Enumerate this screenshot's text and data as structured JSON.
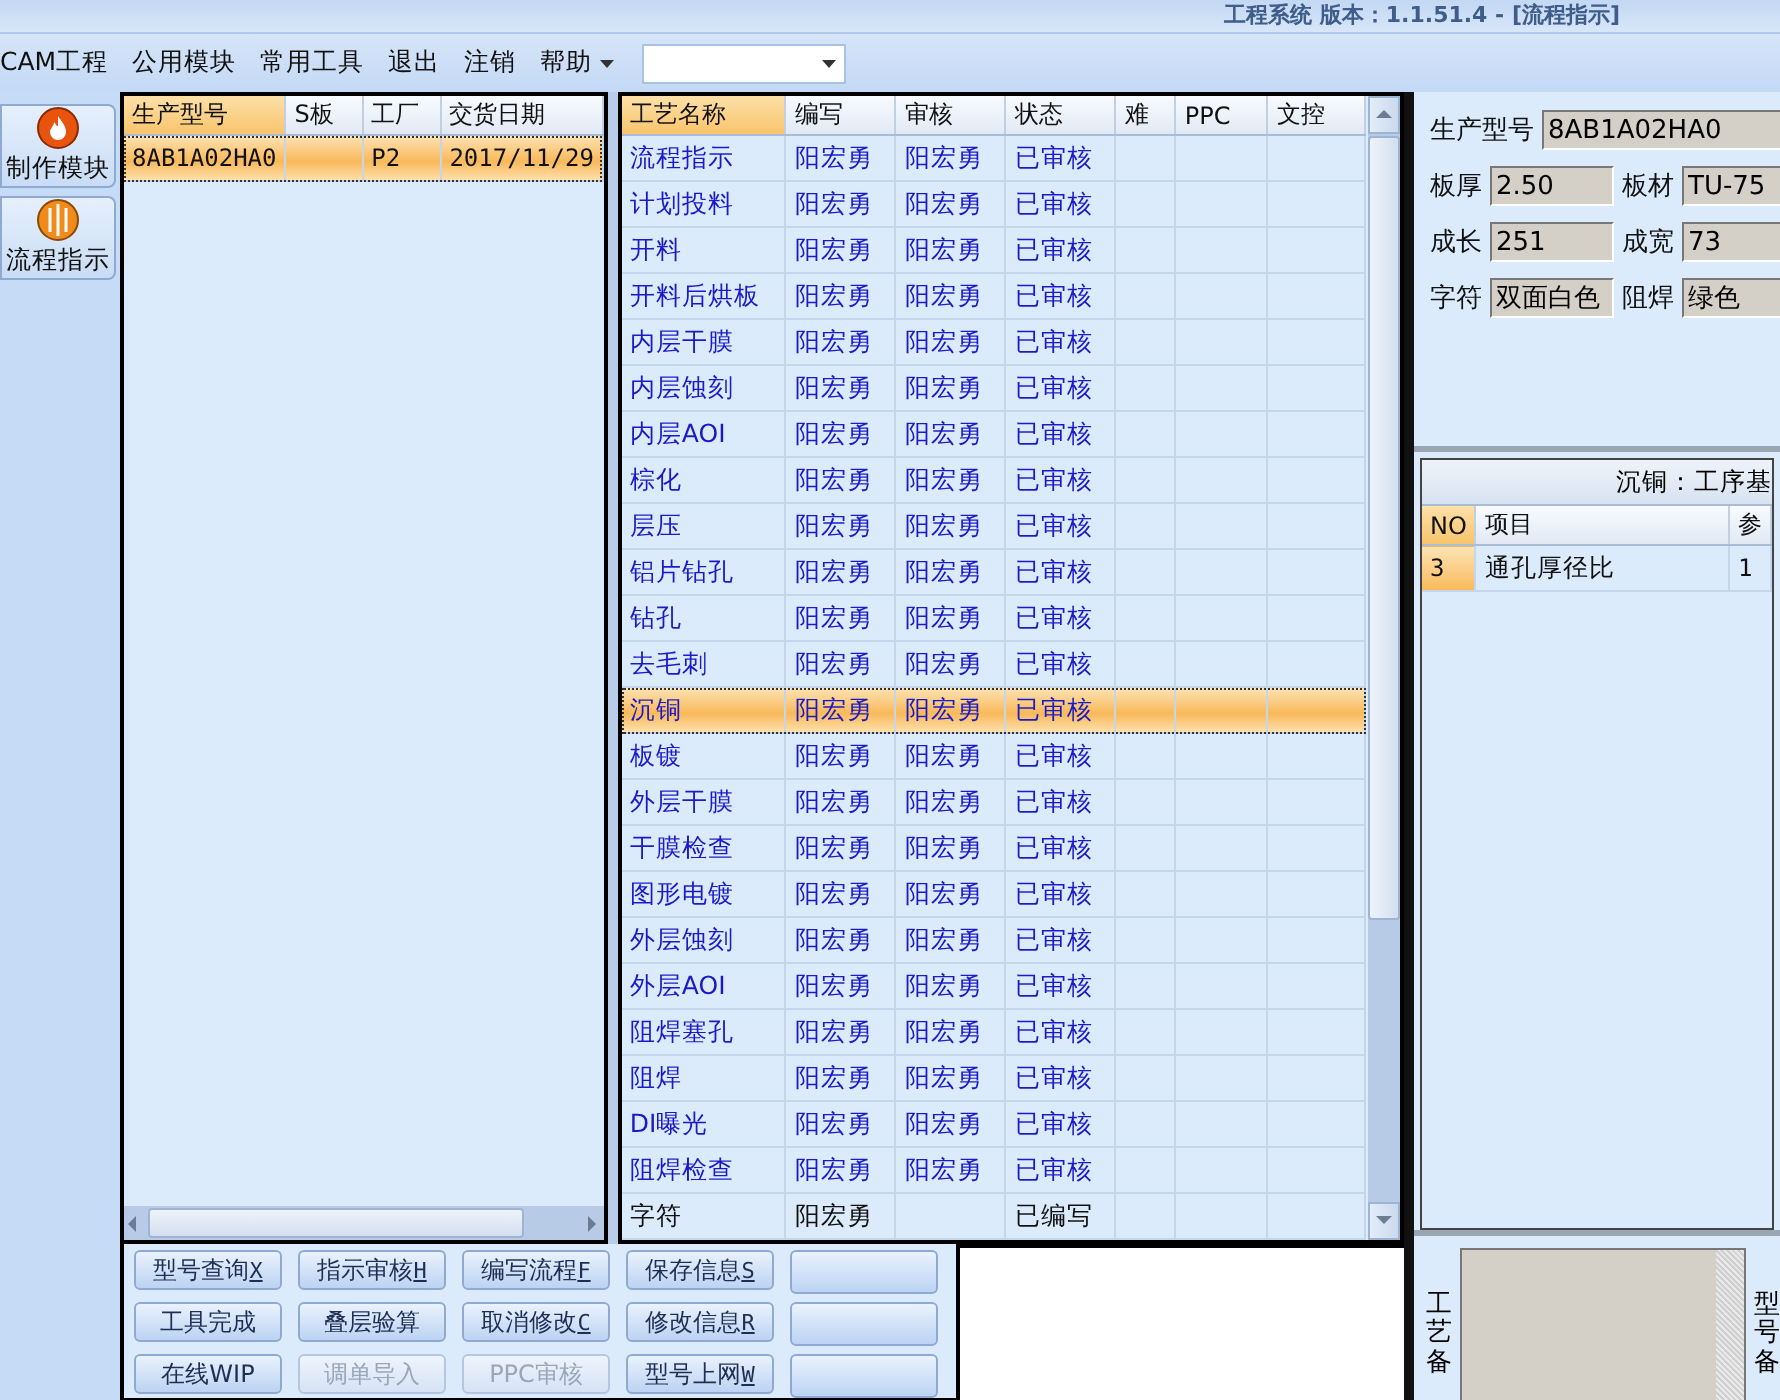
{
  "window": {
    "title": "工程系统 版本：1.1.51.4 - [流程指示]"
  },
  "menu": {
    "items": [
      {
        "label": "CAM工程",
        "dropdown": false
      },
      {
        "label": "公用模块",
        "dropdown": false
      },
      {
        "label": "常用工具",
        "dropdown": false
      },
      {
        "label": "退出",
        "dropdown": false
      },
      {
        "label": "注销",
        "dropdown": false
      },
      {
        "label": "帮助",
        "dropdown": true
      }
    ]
  },
  "sidebar": {
    "items": [
      {
        "label": "制作模块",
        "kind": "flame"
      },
      {
        "label": "流程指示",
        "kind": "globe"
      }
    ]
  },
  "orders": {
    "columns": [
      {
        "label": "生产型号",
        "sorted": true
      },
      {
        "label": "S板",
        "sorted": false
      },
      {
        "label": "工厂",
        "sorted": false
      },
      {
        "label": "交货日期",
        "sorted": false
      }
    ],
    "rows": [
      {
        "cells": [
          "8AB1A02HA0",
          "",
          "P2",
          "2017/11/29"
        ],
        "selected": true
      }
    ]
  },
  "processes": {
    "columns": [
      {
        "label": "工艺名称",
        "sorted": true
      },
      {
        "label": "编写",
        "sorted": false
      },
      {
        "label": "审核",
        "sorted": false
      },
      {
        "label": "状态",
        "sorted": false
      },
      {
        "label": "难",
        "sorted": false
      },
      {
        "label": "PPC",
        "sorted": false
      },
      {
        "label": "文控",
        "sorted": false
      }
    ],
    "rows": [
      {
        "cells": [
          "流程指示",
          "阳宏勇",
          "阳宏勇",
          "已审核",
          "",
          "",
          ""
        ],
        "reviewed": true,
        "selected": false
      },
      {
        "cells": [
          "计划投料",
          "阳宏勇",
          "阳宏勇",
          "已审核",
          "",
          "",
          ""
        ],
        "reviewed": true,
        "selected": false
      },
      {
        "cells": [
          "开料",
          "阳宏勇",
          "阳宏勇",
          "已审核",
          "",
          "",
          ""
        ],
        "reviewed": true,
        "selected": false
      },
      {
        "cells": [
          "开料后烘板",
          "阳宏勇",
          "阳宏勇",
          "已审核",
          "",
          "",
          ""
        ],
        "reviewed": true,
        "selected": false
      },
      {
        "cells": [
          "内层干膜",
          "阳宏勇",
          "阳宏勇",
          "已审核",
          "",
          "",
          ""
        ],
        "reviewed": true,
        "selected": false
      },
      {
        "cells": [
          "内层蚀刻",
          "阳宏勇",
          "阳宏勇",
          "已审核",
          "",
          "",
          ""
        ],
        "reviewed": true,
        "selected": false
      },
      {
        "cells": [
          "内层AOI",
          "阳宏勇",
          "阳宏勇",
          "已审核",
          "",
          "",
          ""
        ],
        "reviewed": true,
        "selected": false
      },
      {
        "cells": [
          "棕化",
          "阳宏勇",
          "阳宏勇",
          "已审核",
          "",
          "",
          ""
        ],
        "reviewed": true,
        "selected": false
      },
      {
        "cells": [
          "层压",
          "阳宏勇",
          "阳宏勇",
          "已审核",
          "",
          "",
          ""
        ],
        "reviewed": true,
        "selected": false
      },
      {
        "cells": [
          "铝片钻孔",
          "阳宏勇",
          "阳宏勇",
          "已审核",
          "",
          "",
          ""
        ],
        "reviewed": true,
        "selected": false
      },
      {
        "cells": [
          "钻孔",
          "阳宏勇",
          "阳宏勇",
          "已审核",
          "",
          "",
          ""
        ],
        "reviewed": true,
        "selected": false
      },
      {
        "cells": [
          "去毛刺",
          "阳宏勇",
          "阳宏勇",
          "已审核",
          "",
          "",
          ""
        ],
        "reviewed": true,
        "selected": false
      },
      {
        "cells": [
          "沉铜",
          "阳宏勇",
          "阳宏勇",
          "已审核",
          "",
          "",
          ""
        ],
        "reviewed": true,
        "selected": true
      },
      {
        "cells": [
          "板镀",
          "阳宏勇",
          "阳宏勇",
          "已审核",
          "",
          "",
          ""
        ],
        "reviewed": true,
        "selected": false
      },
      {
        "cells": [
          "外层干膜",
          "阳宏勇",
          "阳宏勇",
          "已审核",
          "",
          "",
          ""
        ],
        "reviewed": true,
        "selected": false
      },
      {
        "cells": [
          "干膜检查",
          "阳宏勇",
          "阳宏勇",
          "已审核",
          "",
          "",
          ""
        ],
        "reviewed": true,
        "selected": false
      },
      {
        "cells": [
          "图形电镀",
          "阳宏勇",
          "阳宏勇",
          "已审核",
          "",
          "",
          ""
        ],
        "reviewed": true,
        "selected": false
      },
      {
        "cells": [
          "外层蚀刻",
          "阳宏勇",
          "阳宏勇",
          "已审核",
          "",
          "",
          ""
        ],
        "reviewed": true,
        "selected": false
      },
      {
        "cells": [
          "外层AOI",
          "阳宏勇",
          "阳宏勇",
          "已审核",
          "",
          "",
          ""
        ],
        "reviewed": true,
        "selected": false
      },
      {
        "cells": [
          "阻焊塞孔",
          "阳宏勇",
          "阳宏勇",
          "已审核",
          "",
          "",
          ""
        ],
        "reviewed": true,
        "selected": false
      },
      {
        "cells": [
          "阻焊",
          "阳宏勇",
          "阳宏勇",
          "已审核",
          "",
          "",
          ""
        ],
        "reviewed": true,
        "selected": false
      },
      {
        "cells": [
          "DI曝光",
          "阳宏勇",
          "阳宏勇",
          "已审核",
          "",
          "",
          ""
        ],
        "reviewed": true,
        "selected": false
      },
      {
        "cells": [
          "阻焊检查",
          "阳宏勇",
          "阳宏勇",
          "已审核",
          "",
          "",
          ""
        ],
        "reviewed": true,
        "selected": false
      },
      {
        "cells": [
          "字符",
          "阳宏勇",
          "",
          "已编写",
          "",
          "",
          ""
        ],
        "reviewed": false,
        "selected": false
      }
    ]
  },
  "actions": [
    {
      "kind": "command",
      "label": "型号查询",
      "key": "X",
      "disabled": false
    },
    {
      "kind": "command",
      "label": "指示审核",
      "key": "H",
      "disabled": false
    },
    {
      "kind": "command",
      "label": "编写流程",
      "key": "F",
      "disabled": false
    },
    {
      "kind": "command",
      "label": "保存信息",
      "key": "S",
      "disabled": false
    },
    {
      "kind": "blank"
    },
    {
      "kind": "command",
      "label": "工具完成",
      "disabled": false
    },
    {
      "kind": "command",
      "label": "叠层验算",
      "disabled": false
    },
    {
      "kind": "command",
      "label": "取消修改",
      "key": "C",
      "disabled": false
    },
    {
      "kind": "command",
      "label": "修改信息",
      "key": "R",
      "disabled": false
    },
    {
      "kind": "blank"
    },
    {
      "kind": "command",
      "label": "在线WIP",
      "disabled": false
    },
    {
      "kind": "command",
      "label": "调单导入",
      "disabled": true
    },
    {
      "kind": "command",
      "label": "PPC审核",
      "disabled": true
    },
    {
      "kind": "command",
      "label": "型号上网",
      "key": "W",
      "disabled": false
    },
    {
      "kind": "blank"
    }
  ],
  "details": {
    "fields": [
      {
        "label": "生产型号",
        "value": "8AB1A02HA0"
      },
      {
        "label": "板厚",
        "value": "2.50"
      },
      {
        "label": "板材",
        "value": "TU-75"
      },
      {
        "label": "成长",
        "value": "251"
      },
      {
        "label": "成宽",
        "value": "73"
      },
      {
        "label": "字符",
        "value": "双面白色"
      },
      {
        "label": "阻焊",
        "value": "绿色"
      }
    ]
  },
  "parameters": {
    "title": "沉铜：工序基",
    "columns": [
      {
        "label": "NO",
        "sorted": true
      },
      {
        "label": "项目",
        "sorted": false
      },
      {
        "label": "参",
        "sorted": false
      }
    ],
    "rows": [
      {
        "cells": [
          "3",
          "通孔厚径比",
          "1"
        ],
        "selected": true
      }
    ]
  },
  "notes": {
    "label": "工艺备",
    "side_label": "型号备"
  }
}
